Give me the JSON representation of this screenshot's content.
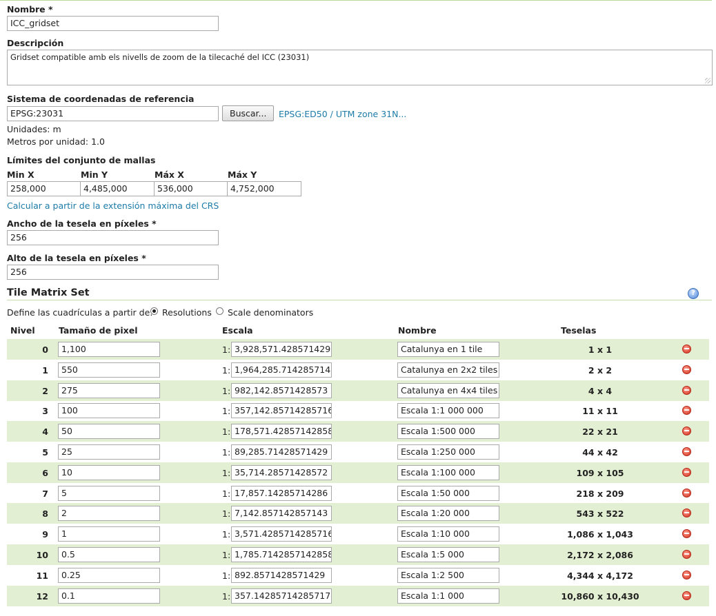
{
  "form": {
    "name_label": "Nombre *",
    "name_value": "ICC_gridset",
    "description_label": "Descripción",
    "description_value": "Gridset compatible amb els nivells de zoom de la tilecaché del ICC (23031)",
    "crs_label": "Sistema de coordenadas de referencia",
    "crs_value": "EPSG:23031",
    "search_button": "Buscar...",
    "crs_link": "EPSG:ED50 / UTM zone 31N...",
    "units_text": "Unidades: m",
    "meters_per_unit_text": "Metros por unidad: 1.0",
    "bounds_label": "Límites del conjunto de mallas",
    "bounds": {
      "minx_label": "Min X",
      "minx_value": "258,000",
      "miny_label": "Min Y",
      "miny_value": "4,485,000",
      "maxx_label": "Máx X",
      "maxx_value": "536,000",
      "maxy_label": "Máx Y",
      "maxy_value": "4,752,000"
    },
    "compute_link": "Calcular a partir de la extensión máxima del CRS",
    "tile_width_label": "Ancho de la tesela en píxeles *",
    "tile_width_value": "256",
    "tile_height_label": "Alto de la tesela en píxeles *",
    "tile_height_value": "256"
  },
  "matrix": {
    "title": "Tile Matrix Set",
    "help_icon": "help-icon",
    "define_label": "Define las cuadrículas a partir de:",
    "option_resolutions": "Resolutions",
    "option_scale": "Scale denominators",
    "selected_option": "Resolutions",
    "headers": {
      "level": "Nivel",
      "pixel_size": "Tamaño de pixel",
      "scale": "Escala",
      "name": "Nombre",
      "tiles": "Teselas"
    },
    "scale_prefix": "1:",
    "rows": [
      {
        "level": "0",
        "pixel_size": "1,100",
        "scale": "3,928,571.428571429",
        "name": "Catalunya en 1 tile",
        "tiles": "1 x 1"
      },
      {
        "level": "1",
        "pixel_size": "550",
        "scale": "1,964,285.714285714",
        "name": "Catalunya en 2x2 tiles",
        "tiles": "2 x 2"
      },
      {
        "level": "2",
        "pixel_size": "275",
        "scale": "982,142.8571428573",
        "name": "Catalunya en 4x4 tiles",
        "tiles": "4 x 4"
      },
      {
        "level": "3",
        "pixel_size": "100",
        "scale": "357,142.85714285716",
        "name": "Escala 1:1 000 000",
        "tiles": "11 x 11"
      },
      {
        "level": "4",
        "pixel_size": "50",
        "scale": "178,571.42857142858",
        "name": "Escala 1:500 000",
        "tiles": "22 x 21"
      },
      {
        "level": "5",
        "pixel_size": "25",
        "scale": "89,285.71428571429",
        "name": "Escala 1:250 000",
        "tiles": "44 x 42"
      },
      {
        "level": "6",
        "pixel_size": "10",
        "scale": "35,714.28571428572",
        "name": "Escala 1:100 000",
        "tiles": "109 x 105"
      },
      {
        "level": "7",
        "pixel_size": "5",
        "scale": "17,857.14285714286",
        "name": "Escala 1:50 000",
        "tiles": "218 x 209"
      },
      {
        "level": "8",
        "pixel_size": "2",
        "scale": "7,142.857142857143",
        "name": "Escala 1:20 000",
        "tiles": "543 x 522"
      },
      {
        "level": "9",
        "pixel_size": "1",
        "scale": "3,571.4285714285716",
        "name": "Escala 1:10 000",
        "tiles": "1,086 x 1,043"
      },
      {
        "level": "10",
        "pixel_size": "0.5",
        "scale": "1,785.7142857142858",
        "name": "Escala 1:5 000",
        "tiles": "2,172 x 2,086"
      },
      {
        "level": "11",
        "pixel_size": "0.25",
        "scale": "892.8571428571429",
        "name": "Escala 1:2 500",
        "tiles": "4,344 x 4,172"
      },
      {
        "level": "12",
        "pixel_size": "0.1",
        "scale": "357.14285714285717",
        "name": "Escala 1:1 000",
        "tiles": "10,860 x 10,430"
      }
    ]
  },
  "colors": {
    "row_alt": "#e3efd3",
    "link": "#1c7ba8",
    "delete": "#d0301c"
  },
  "icons": {
    "delete": "delete-icon",
    "help": "help-icon"
  }
}
